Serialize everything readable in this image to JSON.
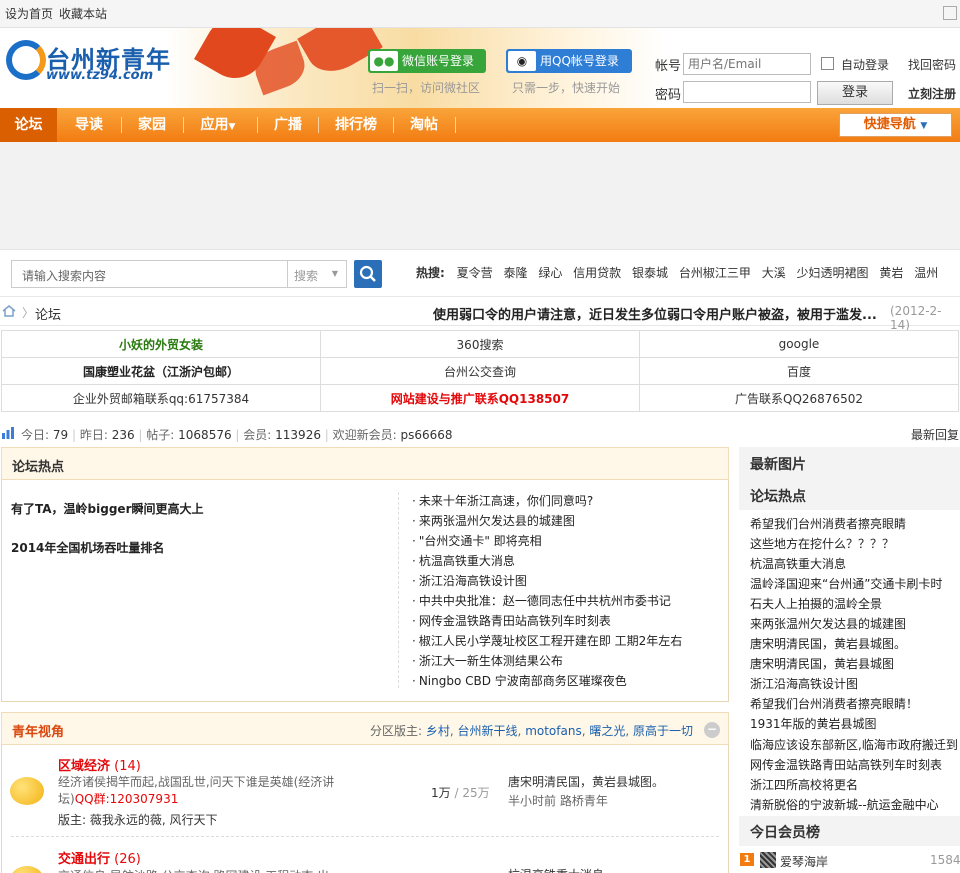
{
  "topbar": {
    "set_home": "设为首页",
    "bookmark": "收藏本站"
  },
  "logo": {
    "cn": "台州新青年",
    "url": "www.tz94.com"
  },
  "social": {
    "wechat_label": "微信账号登录",
    "wechat_hint": "扫一扫，访问微社区",
    "qq_label": "用QQ帐号登录",
    "qq_hint": "只需一步，快速开始"
  },
  "login": {
    "account_label": "帐号",
    "account_placeholder": "用户名/Email",
    "password_label": "密码",
    "auto_login": "自动登录",
    "find_password": "找回密码",
    "login_button": "登录",
    "register": "立刻注册"
  },
  "nav": {
    "items": [
      "论坛",
      "导读",
      "家园",
      "应用",
      "广播",
      "排行榜",
      "淘帖"
    ],
    "quick_nav": "快捷导航"
  },
  "search": {
    "placeholder": "请输入搜索内容",
    "type": "搜索",
    "hot_label": "热搜:",
    "hot_words": [
      "夏令营",
      "泰隆",
      "绿心",
      "信用贷款",
      "银泰城",
      "台州椒江三甲",
      "大溪",
      "少妇透明裙图",
      "黄岩",
      "温州"
    ]
  },
  "breadcrumb": {
    "current": "论坛"
  },
  "notice": {
    "text": "使用弱口令的用户请注意，近日发生多位弱口令用户账户被盗，被用于滥发...",
    "date": "(2012-2-14)"
  },
  "links": [
    [
      "小妖的外贸女装",
      "360搜索",
      "google"
    ],
    [
      "国康塑业花盆（江浙沪包邮）",
      "台州公交查询",
      "百度"
    ],
    [
      "企业外贸邮箱联系qq:61757384",
      "网站建设与推广联系QQ138507",
      "广告联系QQ26876502"
    ]
  ],
  "colors": {
    "green_link": "#2a7a10",
    "red_link": "#e4080a",
    "accent": "#f27c12",
    "blue": "#1a5fae"
  },
  "stats": {
    "today_label": "今日:",
    "today": "79",
    "yesterday_label": "昨日:",
    "yesterday": "236",
    "posts_label": "帖子:",
    "posts": "1068576",
    "members_label": "会员:",
    "members": "113926",
    "welcome_label": "欢迎新会员:",
    "newest": "ps66668",
    "latest_reply": "最新回复"
  },
  "hot": {
    "title": "论坛热点",
    "left": [
      "有了TA，温岭bigger瞬间更高大上",
      "2014年全国机场吞吐量排名"
    ],
    "right": [
      "未来十年浙江高速，你们同意吗?",
      "来两张温州欠发达县的城建图",
      "\"台州交通卡\" 即将亮相",
      "杭温高铁重大消息",
      "浙江沿海高铁设计图",
      "中共中央批准：赵一德同志任中共杭州市委书记",
      "网传金温铁路青田站高铁列车时刻表",
      "椒江人民小学蔑址校区工程开建在即 工期2年左右",
      "浙江大一新生体测结果公布",
      "Ningbo CBD 宁波南部商务区璀璨夜色"
    ]
  },
  "section": {
    "title": "青年视角",
    "moderator_label": "分区版主:",
    "moderators": [
      "乡村",
      "台州新干线",
      "motofans",
      "曙之光",
      "原高于一切"
    ],
    "forums": [
      {
        "name": "区域经济",
        "count": "(14)",
        "desc": "经济诸侯揭竿而起,战国乱世,问天下谁是英雄(经济讲坛)",
        "qq": "QQ群:120307931",
        "mod_label": "版主:",
        "mods": "薇我永远的薇, 风行天下",
        "threads": "1万",
        "posts": "/ 25万",
        "last_title": "唐宋明清民国，黄岩县城图。",
        "last_time": "半小时前",
        "last_user": "路桥青年"
      },
      {
        "name": "交通出行",
        "count": "(26)",
        "desc": "交通信息,导航沙路,公交查询,路网建设,工程动态,出",
        "qq": "",
        "mod_label": "",
        "mods": "",
        "threads": "",
        "posts": "",
        "last_title": "杭温高铁重大消息",
        "last_time": "",
        "last_user": ""
      }
    ]
  },
  "sidebar": {
    "new_pics": "最新图片",
    "hot_title": "论坛热点",
    "hot_items": [
      "希望我们台州消费者擦亮眼睛",
      "这些地方在挖什么？？？？",
      "杭温高铁重大消息",
      "温岭泽国迎来“台州通”交通卡刷卡时",
      "石夫人上拍摄的温岭全景",
      "来两张温州欠发达县的城建图",
      "唐宋明清民国，黄岩县城图。",
      "唐宋明清民国，黄岩县城图",
      "浙江沿海高铁设计图",
      "希望我们台州消费者擦亮眼睛！",
      "1931年版的黄岩县城图",
      "临海应该设东部新区,临海市政府搬迁到",
      "网传金温铁路青田站高铁列车时刻表",
      "浙江四所高校将更名",
      "清新脱俗的宁波新城--航运金融中心"
    ],
    "members_title": "今日会员榜",
    "member_rank": "1",
    "member_name": "爱琴海岸",
    "member_score": "1584"
  }
}
